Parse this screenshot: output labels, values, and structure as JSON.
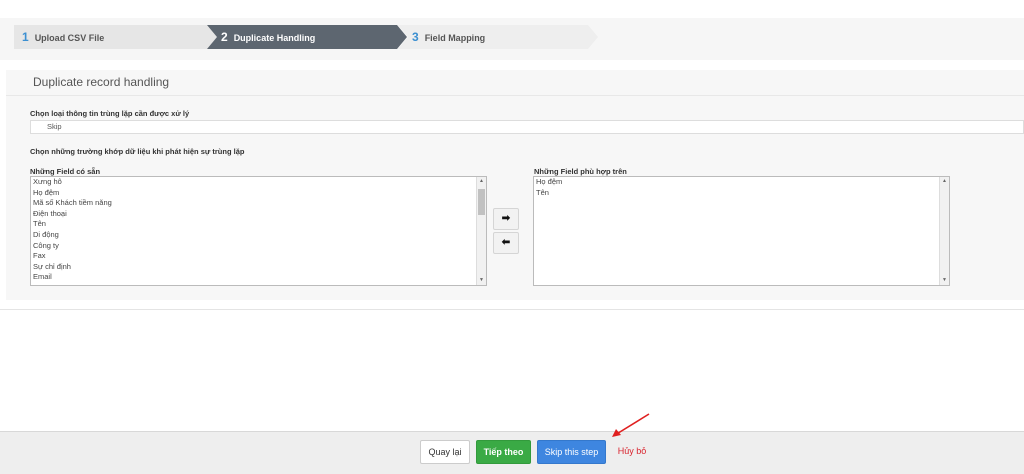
{
  "wizard": {
    "steps": [
      {
        "num": "1",
        "label": "Upload CSV File"
      },
      {
        "num": "2",
        "label": "Duplicate Handling"
      },
      {
        "num": "3",
        "label": "Field Mapping"
      }
    ]
  },
  "panel": {
    "title": "Duplicate record handling",
    "duplicate_type_label": "Chọn loại thông tin trùng lặp cần được xử lý",
    "duplicate_type_value": "Skip",
    "match_fields_label": "Chọn những trường khớp dữ liệu khi phát hiện sự trùng lặp",
    "available_label": "Những Field có sẵn",
    "available_fields": [
      "Xưng hô",
      "Họ đệm",
      "Mã số Khách tiềm năng",
      "Điện thoại",
      "Tên",
      "Di động",
      "Công ty",
      "Fax",
      "Sự chỉ định",
      "Email"
    ],
    "matched_label": "Những Field phù hợp trên",
    "matched_fields": [
      "Họ đệm",
      "Tên"
    ],
    "move_right_glyph": "➡",
    "move_left_glyph": "⬅"
  },
  "footer": {
    "back_label": "Quay lại",
    "next_label": "Tiếp theo",
    "skip_label": "Skip this step",
    "cancel_label": "Hủy bỏ"
  },
  "colors": {
    "active_step": "#5d6670",
    "next_button": "#3aaa45",
    "skip_button": "#3e86e0",
    "cancel_text": "#d9232d",
    "annotation_arrow": "#e02020"
  }
}
